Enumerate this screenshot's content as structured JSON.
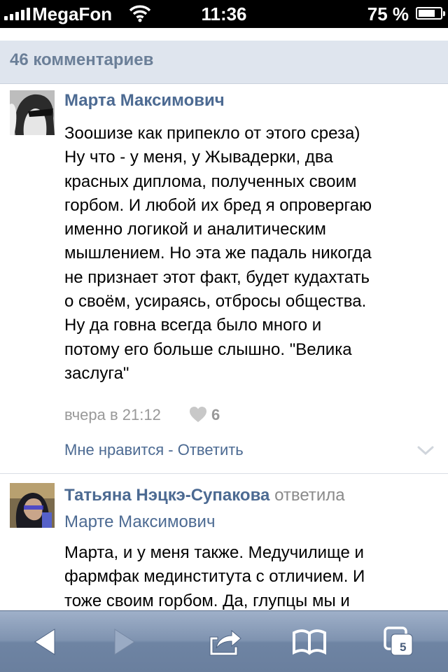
{
  "status_bar": {
    "carrier": "MegaFon",
    "time": "11:36",
    "battery_percent": "75 %",
    "battery_level": 0.75,
    "signal_icon": "signal-bars-icon",
    "wifi_icon": "wifi-icon"
  },
  "comments": {
    "count_label": "46 комментариев",
    "items": [
      {
        "author": "Марта Максимович",
        "lines": [
          "Зоошизе как припекло от этого среза)",
          "Ну что - у меня, у Жывадерки, два",
          "красных диплома, полученных своим",
          "горбом. И любой их бред я опровергаю",
          "именно логикой и аналитическим",
          "мышлением. Но эта же падаль никогда",
          "не признает этот факт, будет кудахтать",
          "о своём, усираясь, отбросы общества.",
          "Ну да говна всегда было много и",
          "потому его больше слышно. \"Велика",
          "заслуга\""
        ],
        "timestamp": "вчера в 21:12",
        "likes": "6",
        "like_label": "Мне нравится",
        "separator": " - ",
        "reply_label": "Ответить"
      },
      {
        "author": "Татьяна Нэцкэ-Супакова",
        "reply_word": "ответила",
        "reply_to": "Марте Максимович",
        "lines": [
          "Марта, и у меня также. Медучилище и",
          "фармфак мединститута с отличием. И",
          "тоже своим горбом. Да, глупцы мы и"
        ]
      }
    ]
  },
  "toolbar": {
    "tab_count": "5",
    "icons": [
      "back-arrow-icon",
      "forward-arrow-icon",
      "share-icon",
      "bookmarks-icon",
      "tabs-icon"
    ]
  },
  "colors": {
    "link": "#4c6a92",
    "header_bg": "#dfe5ee",
    "toolbar": "#7f93b0"
  }
}
